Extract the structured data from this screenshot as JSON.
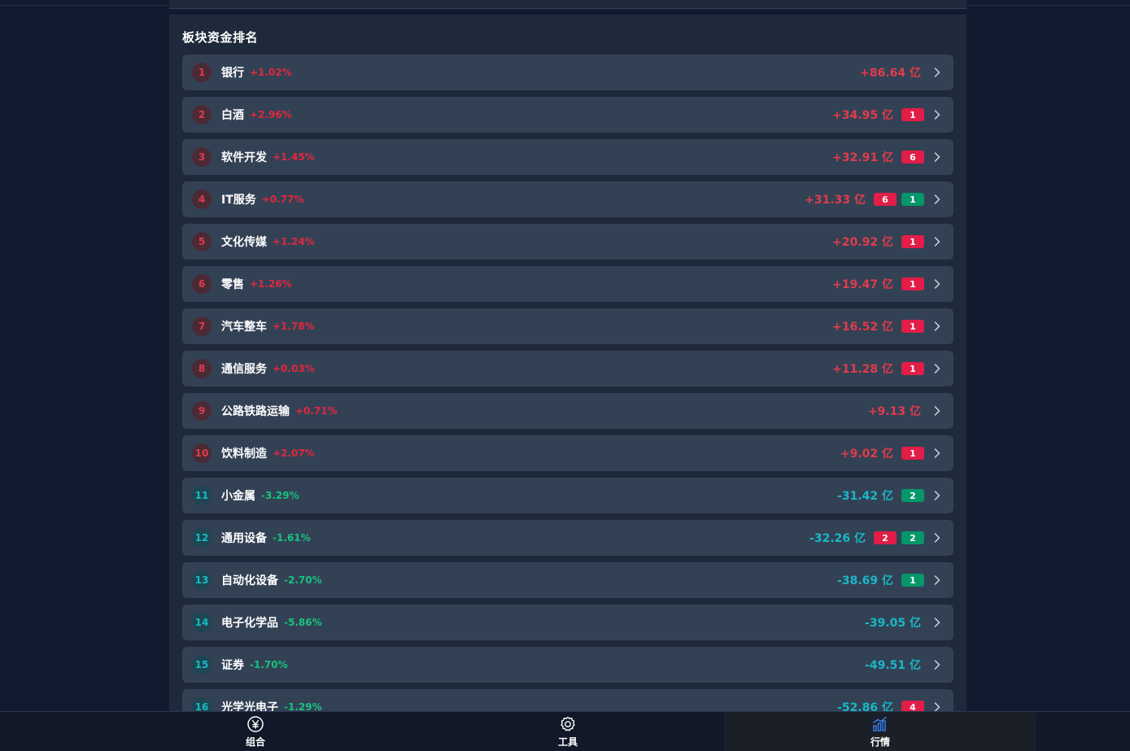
{
  "section": {
    "title": "板块资金排名"
  },
  "rows": [
    {
      "rank": "1",
      "name": "银行",
      "pct": "+1.02%",
      "amount": "+86.64 亿",
      "dir": "up",
      "badges": []
    },
    {
      "rank": "2",
      "name": "白酒",
      "pct": "+2.96%",
      "amount": "+34.95 亿",
      "dir": "up",
      "badges": [
        {
          "value": "1",
          "color": "red"
        }
      ]
    },
    {
      "rank": "3",
      "name": "软件开发",
      "pct": "+1.45%",
      "amount": "+32.91 亿",
      "dir": "up",
      "badges": [
        {
          "value": "6",
          "color": "red"
        }
      ]
    },
    {
      "rank": "4",
      "name": "IT服务",
      "pct": "+0.77%",
      "amount": "+31.33 亿",
      "dir": "up",
      "badges": [
        {
          "value": "6",
          "color": "red"
        },
        {
          "value": "1",
          "color": "green"
        }
      ]
    },
    {
      "rank": "5",
      "name": "文化传媒",
      "pct": "+1.24%",
      "amount": "+20.92 亿",
      "dir": "up",
      "badges": [
        {
          "value": "1",
          "color": "red"
        }
      ]
    },
    {
      "rank": "6",
      "name": "零售",
      "pct": "+1.26%",
      "amount": "+19.47 亿",
      "dir": "up",
      "badges": [
        {
          "value": "1",
          "color": "red"
        }
      ]
    },
    {
      "rank": "7",
      "name": "汽车整车",
      "pct": "+1.78%",
      "amount": "+16.52 亿",
      "dir": "up",
      "badges": [
        {
          "value": "1",
          "color": "red"
        }
      ]
    },
    {
      "rank": "8",
      "name": "通信服务",
      "pct": "+0.03%",
      "amount": "+11.28 亿",
      "dir": "up",
      "badges": [
        {
          "value": "1",
          "color": "red"
        }
      ]
    },
    {
      "rank": "9",
      "name": "公路铁路运输",
      "pct": "+0.71%",
      "amount": "+9.13 亿",
      "dir": "up",
      "badges": []
    },
    {
      "rank": "10",
      "name": "饮料制造",
      "pct": "+2.07%",
      "amount": "+9.02 亿",
      "dir": "up",
      "badges": [
        {
          "value": "1",
          "color": "red"
        }
      ]
    },
    {
      "rank": "11",
      "name": "小金属",
      "pct": "-3.29%",
      "amount": "-31.42 亿",
      "dir": "down",
      "badges": [
        {
          "value": "2",
          "color": "green"
        }
      ]
    },
    {
      "rank": "12",
      "name": "通用设备",
      "pct": "-1.61%",
      "amount": "-32.26 亿",
      "dir": "down",
      "badges": [
        {
          "value": "2",
          "color": "red"
        },
        {
          "value": "2",
          "color": "green"
        }
      ]
    },
    {
      "rank": "13",
      "name": "自动化设备",
      "pct": "-2.70%",
      "amount": "-38.69 亿",
      "dir": "down",
      "badges": [
        {
          "value": "1",
          "color": "green"
        }
      ]
    },
    {
      "rank": "14",
      "name": "电子化学品",
      "pct": "-5.86%",
      "amount": "-39.05 亿",
      "dir": "down",
      "badges": []
    },
    {
      "rank": "15",
      "name": "证券",
      "pct": "-1.70%",
      "amount": "-49.51 亿",
      "dir": "down",
      "badges": []
    },
    {
      "rank": "16",
      "name": "光学光电子",
      "pct": "-1.29%",
      "amount": "-52.86 亿",
      "dir": "down",
      "badges": [
        {
          "value": "4",
          "color": "red"
        }
      ]
    }
  ],
  "nav": {
    "items": [
      {
        "label": "组合",
        "icon": "yen-coin-icon"
      },
      {
        "label": "工具",
        "icon": "gear-icon"
      },
      {
        "label": "行情",
        "icon": "bar-chart-icon"
      }
    ],
    "active_index": 2
  },
  "colors": {
    "up": "#e23b4b",
    "down": "#19b8c6",
    "badge_red": "#e11d48",
    "badge_green": "#059669",
    "active_icon": "#3b82f6"
  }
}
